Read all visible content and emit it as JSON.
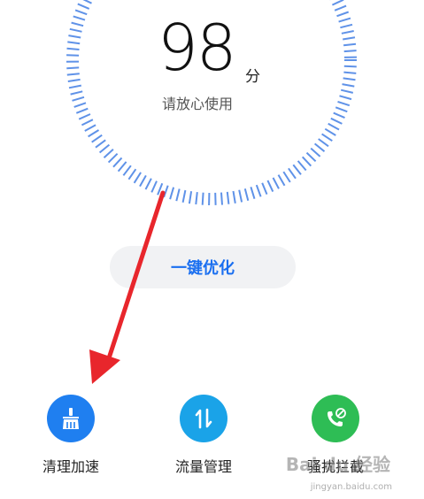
{
  "score": {
    "value": "98",
    "unit": "分",
    "status": "请放心使用"
  },
  "optimize_button": {
    "label": "一键优化"
  },
  "tools": [
    {
      "label": "清理加速",
      "icon": "broom-icon",
      "color": "#1f7ff0"
    },
    {
      "label": "流量管理",
      "icon": "data-transfer-icon",
      "color": "#1aa3e8"
    },
    {
      "label": "骚扰拦截",
      "icon": "call-block-icon",
      "color": "#2ebd55"
    }
  ],
  "colors": {
    "accent": "#1a6ff0",
    "dial_tick": "#5f92e8",
    "arrow": "#e8262c"
  },
  "watermark": {
    "text": "Bai du 经验",
    "url_text": "jingyan.baidu.com"
  }
}
